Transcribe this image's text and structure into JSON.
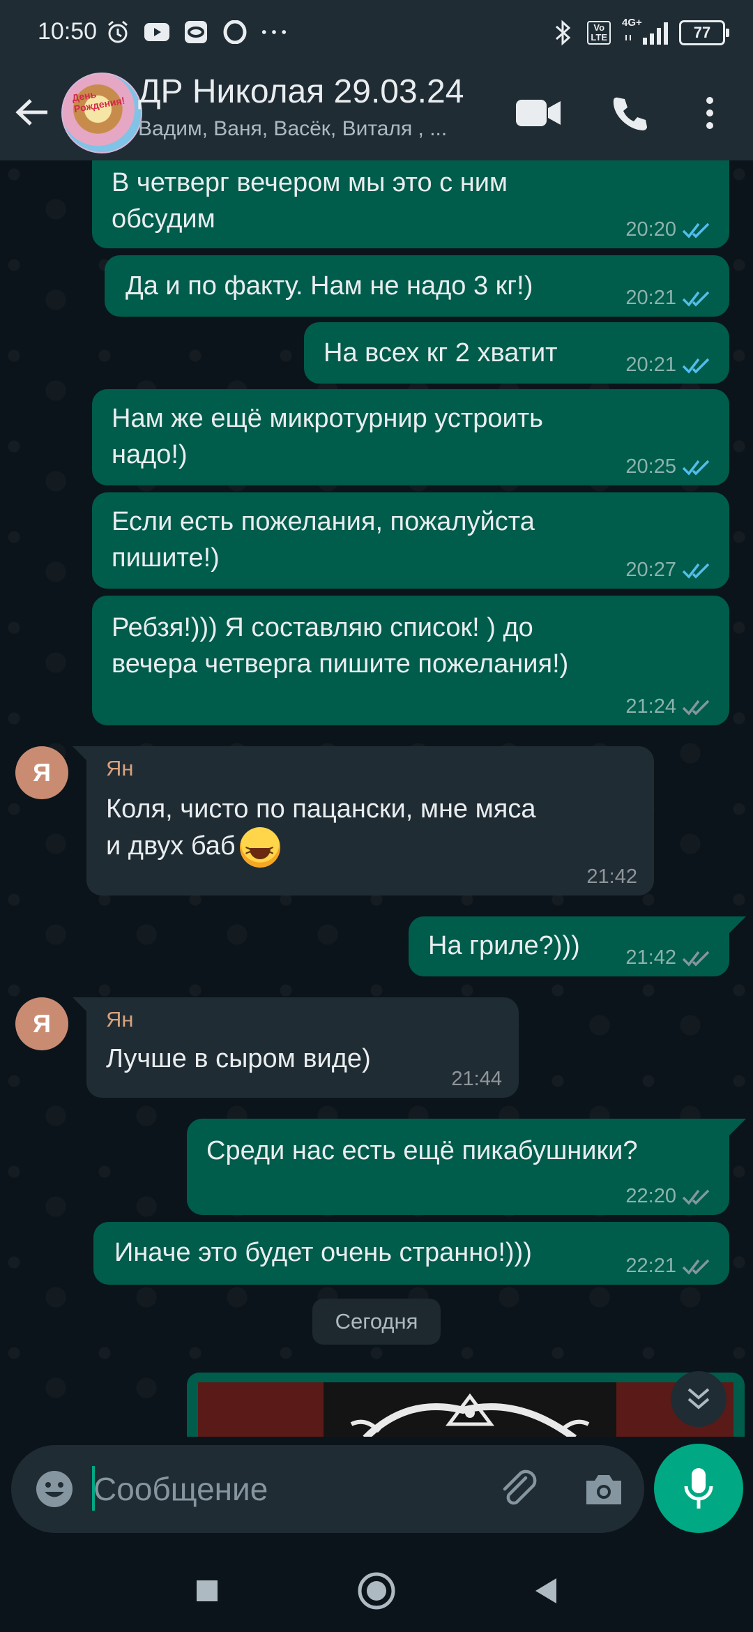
{
  "status_bar": {
    "time": "10:50",
    "left_icons": [
      "alarm-icon",
      "youtube-icon",
      "app-icon",
      "opera-icon",
      "more-dots-icon"
    ],
    "right_icons": [
      "bluetooth-icon",
      "volte-icon",
      "signal-4g-icon"
    ],
    "volte_label": "Vo\nLTE",
    "network_label": "4G+",
    "battery": "77"
  },
  "header": {
    "title": "ДР Николая 29.03.24",
    "subtitle": "Вадим, Ваня, Васёк, Виталя , ...",
    "avatar_caption": "День Рождения!"
  },
  "messages": [
    {
      "dir": "out",
      "text": "В четверг вечером мы это с ним\nобсудим",
      "time": "20:20",
      "read": true
    },
    {
      "dir": "out",
      "text": "Да и по факту. Нам не надо 3 кг!)",
      "time": "20:21",
      "read": true
    },
    {
      "dir": "out",
      "text": "На всех кг 2 хватит",
      "time": "20:21",
      "read": true
    },
    {
      "dir": "out",
      "text": "Нам же ещё микротурнир устроить\nнадо!)",
      "time": "20:25",
      "read": true
    },
    {
      "dir": "out",
      "text": "Если есть пожелания, пожалуйста\nпишите!)",
      "time": "20:27",
      "read": true
    },
    {
      "dir": "out",
      "text": "Ребзя!))) Я составляю список! ) до\nвечера четверга пишите пожелания!)",
      "time": "21:24",
      "read": false
    },
    {
      "dir": "in",
      "sender": "Ян",
      "avatar": "Я",
      "text": "Коля, чисто по пацански, мне мяса\nи двух баб",
      "emoji": "grinning-squinting-face",
      "time": "21:42"
    },
    {
      "dir": "out",
      "text": "На гриле?)))",
      "time": "21:42",
      "read": false
    },
    {
      "dir": "in",
      "sender": "Ян",
      "avatar": "Я",
      "text": "Лучше в сыром виде)",
      "time": "21:44"
    },
    {
      "dir": "out",
      "text": "Среди нас есть ещё пикабушники?",
      "time": "22:20",
      "read": false
    },
    {
      "dir": "out",
      "text": "Иначе это будет очень странно!)))",
      "time": "22:21",
      "read": false
    }
  ],
  "date_separator": "Сегодня",
  "input": {
    "placeholder": "Сообщение"
  },
  "colors": {
    "outgoing": "#005c4b",
    "incoming": "#202c33",
    "accent": "#00a884",
    "read_tick": "#53bdeb",
    "sent_tick": "#8696a0",
    "sender_name": "#d8a27e"
  }
}
